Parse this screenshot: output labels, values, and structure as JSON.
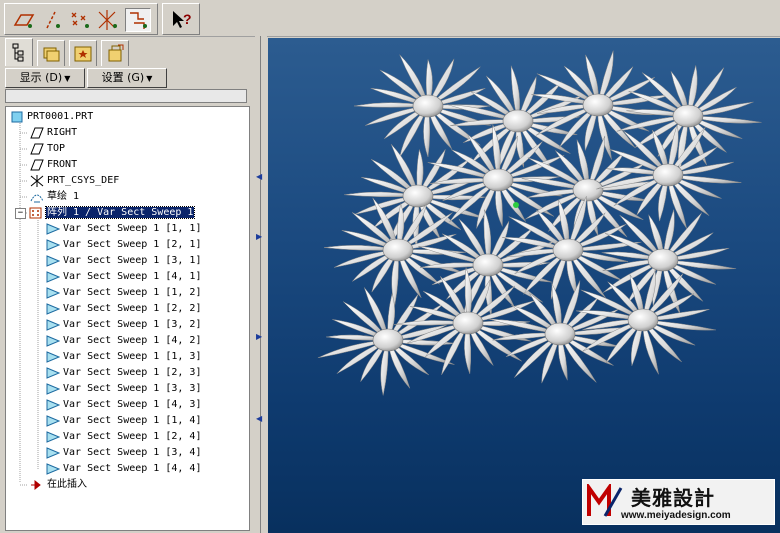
{
  "toolbar": {
    "buttons": [
      {
        "icon": "datum-plane-display-icon"
      },
      {
        "icon": "datum-axis-display-icon"
      },
      {
        "icon": "datum-point-display-icon"
      },
      {
        "icon": "coordinate-system-display-icon"
      },
      {
        "icon": "spin-center-display-icon"
      },
      {
        "icon": "context-help-icon",
        "label": "?"
      }
    ]
  },
  "tabs": [
    {
      "icon": "model-tree-icon"
    },
    {
      "icon": "folder-browser-icon"
    },
    {
      "icon": "favorites-icon"
    },
    {
      "icon": "connections-icon"
    }
  ],
  "menus": {
    "show_label": "显示 (D)",
    "settings_label": "设置 (G)"
  },
  "tree": {
    "root": "PRT0001.PRT",
    "items": [
      {
        "label": "RIGHT",
        "icon": "datum-plane-icon"
      },
      {
        "label": "TOP",
        "icon": "datum-plane-icon"
      },
      {
        "label": "FRONT",
        "icon": "datum-plane-icon"
      },
      {
        "label": "PRT_CSYS_DEF",
        "icon": "csys-icon"
      },
      {
        "label": "草绘 1",
        "icon": "sketch-icon"
      },
      {
        "label": "阵列 1 / Var Sect Sweep 1",
        "icon": "pattern-icon",
        "expander": "−"
      }
    ],
    "children": [
      "Var Sect Sweep 1 [1, 1]",
      "Var Sect Sweep 1 [2, 1]",
      "Var Sect Sweep 1 [3, 1]",
      "Var Sect Sweep 1 [4, 1]",
      "Var Sect Sweep 1 [1, 2]",
      "Var Sect Sweep 1 [2, 2]",
      "Var Sect Sweep 1 [3, 2]",
      "Var Sect Sweep 1 [4, 2]",
      "Var Sect Sweep 1 [1, 3]",
      "Var Sect Sweep 1 [2, 3]",
      "Var Sect Sweep 1 [3, 3]",
      "Var Sect Sweep 1 [4, 3]",
      "Var Sect Sweep 1 [1, 4]",
      "Var Sect Sweep 1 [2, 4]",
      "Var Sect Sweep 1 [3, 4]",
      "Var Sect Sweep 1 [4, 4]"
    ],
    "insert_here": "在此插入"
  },
  "viewport": {
    "background_top": "#2c5c90",
    "background_bottom": "#08305e",
    "model_color": "#e8e8e8"
  },
  "watermark": {
    "cn": "美雅設計",
    "url": "www.meiyadesign.com"
  },
  "colors": {
    "selection": "#0a246a",
    "chrome": "#d4d0c8"
  }
}
